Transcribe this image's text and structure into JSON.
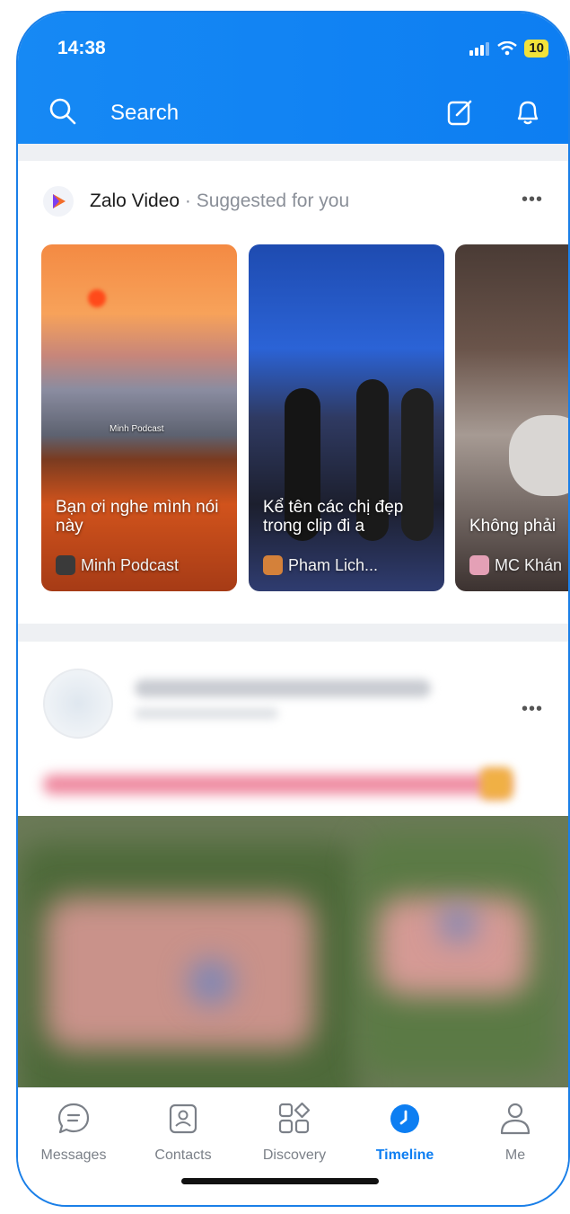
{
  "status": {
    "time": "14:38",
    "battery": "10"
  },
  "header": {
    "search_label": "Search"
  },
  "suggested": {
    "source": "Zalo Video",
    "subtitle": " · Suggested for you",
    "videos": [
      {
        "caption": "Bạn ơi nghe mình nói này",
        "author": "Minh Podcast",
        "overlay": "Minh Podcast"
      },
      {
        "caption": "Kể tên các chị đẹp trong clip đi a",
        "author": "Pham Lich..."
      },
      {
        "caption": "Không phải",
        "author": "MC Khán"
      }
    ]
  },
  "tabs": [
    {
      "label": "Messages",
      "icon": "chat-bubble-icon"
    },
    {
      "label": "Contacts",
      "icon": "contact-card-icon"
    },
    {
      "label": "Discovery",
      "icon": "grid-icon"
    },
    {
      "label": "Timeline",
      "icon": "clock-icon",
      "active": true
    },
    {
      "label": "Me",
      "icon": "person-icon"
    }
  ],
  "colors": {
    "brand": "#0d7ef2",
    "tab_inactive": "#7b8088"
  }
}
